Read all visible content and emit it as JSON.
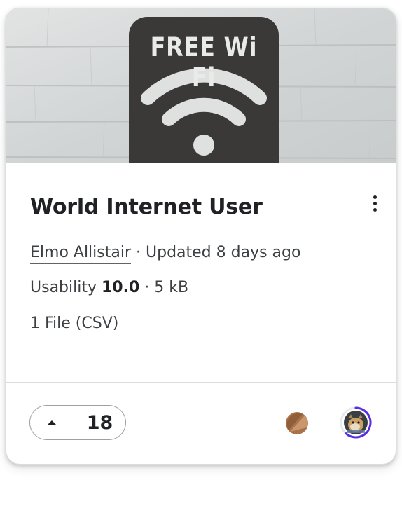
{
  "card": {
    "title": "World Internet User",
    "owner": "Elmo Allistair",
    "updated": " · Updated 8 days ago",
    "usability_label": "Usability ",
    "usability_score": "10.0",
    "size": " · 5 kB",
    "files": "1 File (CSV)",
    "thumbnail": {
      "sign_text": "FREE Wi Fi",
      "icon": "wifi-icon"
    },
    "menu_icon": "more-vert-icon"
  },
  "footer": {
    "upvote_icon": "upvote-icon",
    "vote_count": "18"
  },
  "colors": {
    "accent_ring": "#5b2be3",
    "avatar1": "#a8734a",
    "border": "#dadce0"
  }
}
